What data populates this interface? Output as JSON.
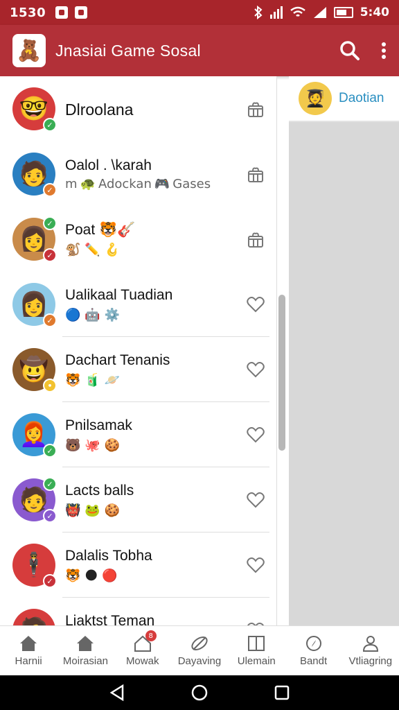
{
  "status_bar": {
    "time": "1530",
    "right_time": "5:40"
  },
  "app_bar": {
    "title": "Jnasiai  Game Sosal",
    "logo_emoji": "🧸"
  },
  "list": [
    {
      "name": "Dlroolana",
      "sub": "",
      "avatar": "🤓",
      "avatar_bg": "#d63c3c",
      "badge": "✓",
      "badge_color": "#3aae55",
      "badge_pos": "bottom",
      "action": "gift-icon",
      "tags": []
    },
    {
      "name": "Oalol . \\karah",
      "sub_prefix": "m",
      "sub_tag1_icon": "🐢",
      "sub_tag1": "Adockan",
      "sub_tag2_icon": "🎮",
      "sub_tag2": "Gases",
      "avatar": "🧑",
      "avatar_bg": "#2a7fc1",
      "badge": "✓",
      "badge_color": "#e07a2e",
      "badge_pos": "bottom",
      "action": "gift-icon",
      "tags": []
    },
    {
      "name": "Poat",
      "name_emoji": "🐯🎸",
      "avatar": "👩",
      "avatar_bg": "#c98b4a",
      "badge": "✓",
      "badge_color": "#3aae55",
      "badge_pos": "top",
      "badge2": "✓",
      "badge2_color": "#c8323a",
      "action": "gift-icon",
      "tags": [
        "🐒",
        "✏️",
        "🪝"
      ]
    },
    {
      "name": "Ualikaal Tuadian",
      "avatar": "👩",
      "avatar_bg": "#8ec9e6",
      "badge": "✓",
      "badge_color": "#e07a2e",
      "badge_pos": "bottom",
      "action": "heart-icon",
      "tags": [
        "🔵",
        "🤖",
        "⚙️"
      ]
    },
    {
      "name": "Dachart Tenanis",
      "avatar": "🤠",
      "avatar_bg": "#8a5a2b",
      "badge": "•",
      "badge_color": "#f2c230",
      "badge_pos": "bottom",
      "action": "heart-icon",
      "tags": [
        "🐯",
        "🧃",
        "🪐"
      ]
    },
    {
      "name": "Pnilsamak",
      "avatar": "👩‍🦰",
      "avatar_bg": "#3a9ad6",
      "badge": "✓",
      "badge_color": "#3aae55",
      "badge_pos": "bottom",
      "action": "heart-icon",
      "tags": [
        "🐻",
        "🐙",
        "🍪"
      ]
    },
    {
      "name": "Lacts balls",
      "avatar": "🧑",
      "avatar_bg": "#8a5acf",
      "badge": "✓",
      "badge_color": "#3aae55",
      "badge_pos": "top",
      "badge2": "✓",
      "badge2_color": "#8a5acf",
      "action": "heart-icon",
      "tags": [
        "👹",
        "🐸",
        "🍪"
      ]
    },
    {
      "name": "Dalalis Tobha",
      "avatar": "🕴️",
      "avatar_bg": "#d63c3c",
      "badge": "✓",
      "badge_color": "#c8323a",
      "badge_pos": "bottom",
      "action": "heart-icon",
      "tags": [
        "🐯",
        "🌑",
        "🔴"
      ]
    },
    {
      "name": "Liaktst Teman",
      "avatar": "🧑",
      "avatar_bg": "#d63c3c",
      "badge": "✓",
      "badge_color": "#c8323a",
      "badge_pos": "bottom",
      "action": "heart-icon",
      "tags": [
        "🐯",
        "⚪",
        "🍪"
      ]
    }
  ],
  "right_panel": {
    "name": "Daotian",
    "avatar": "🧑‍🎓"
  },
  "bottom_nav": [
    {
      "label": "Harnii",
      "icon": "home-icon"
    },
    {
      "label": "Moirasian",
      "icon": "home-filled-icon"
    },
    {
      "label": "Mowak",
      "icon": "house-outline-icon",
      "badge": "8"
    },
    {
      "label": "Dayaving",
      "icon": "rocket-icon"
    },
    {
      "label": "Ulemain",
      "icon": "book-icon"
    },
    {
      "label": "Bandt",
      "icon": "compass-icon"
    },
    {
      "label": "Vtliagring",
      "icon": "person-icon"
    }
  ],
  "colors": {
    "brand": "#b23038",
    "status": "#a8252b",
    "accent": "#2a8fc1"
  }
}
